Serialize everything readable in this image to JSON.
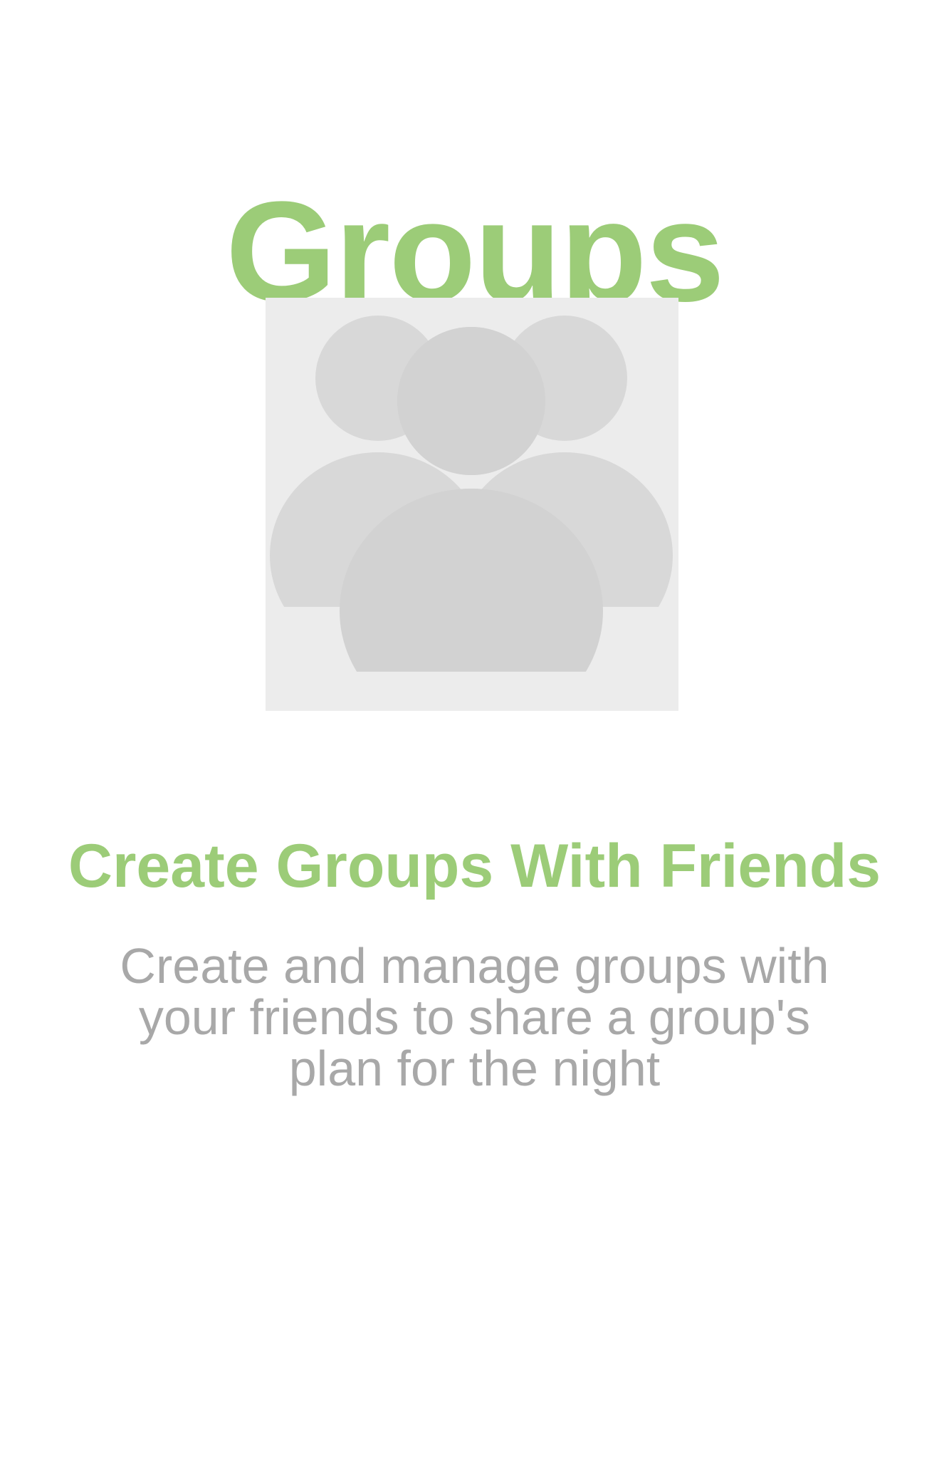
{
  "theme": {
    "accent_color": "#9ccc78",
    "body_text_color": "#a8a8a8",
    "illustration_background": "#ececec",
    "illustration_side_figures": "#d8d8d8",
    "illustration_center_figure": "#d2d2d2"
  },
  "onboarding": {
    "title": "Groups",
    "illustration_icon": "group-of-people-icon",
    "headline": "Create Groups With Friends",
    "description": "Create and manage groups with your friends to share a group's plan for the night"
  }
}
